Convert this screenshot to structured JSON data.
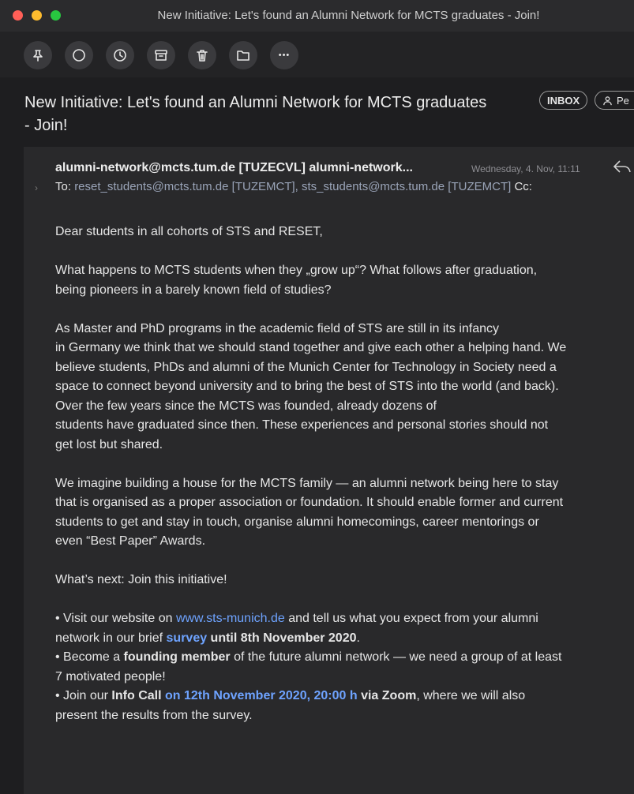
{
  "window": {
    "title": "New Initiative: Let's found an Alumni Network for MCTS graduates - Join!"
  },
  "toolbar": {
    "buttons": [
      {
        "icon": "pin-icon"
      },
      {
        "icon": "circle-icon"
      },
      {
        "icon": "clock-icon"
      },
      {
        "icon": "archive-icon"
      },
      {
        "icon": "trash-icon"
      },
      {
        "icon": "folder-icon"
      },
      {
        "icon": "more-icon",
        "glyph": "•••"
      }
    ]
  },
  "header": {
    "subject_line1": "New Initiative: Let's found an Alumni Network for MCTS graduates",
    "subject_line2": "- Join!",
    "badge_inbox": "INBOX",
    "badge_people": "Pe"
  },
  "message": {
    "from": "alumni-network@mcts.tum.de [TUZECVL] alumni-network...",
    "date": "Wednesday, 4. Nov, 11:11",
    "expand_glyph": "›",
    "to_label": "To:",
    "to_addresses": "reset_students@mcts.tum.de [TUZEMCT], sts_students@mcts.tum.de [TUZEMCT]",
    "cc_label": "Cc:",
    "greeting": "Dear students in all cohorts of STS and RESET,",
    "p1_l1": "What happens to MCTS students when they „grow up“? What follows after graduation,",
    "p1_l2": "being pioneers in a barely known field of studies?",
    "p2_l1": "As Master and PhD programs in the academic field of STS are still in its infancy",
    "p2_l2": "in Germany we think that we should stand together and give each other a helping hand. We",
    "p2_l3": "believe students, PhDs and alumni of the Munich Center for Technology in Society need a",
    "p2_l4": "space to connect beyond university and to bring the best of STS into the world (and back).",
    "p2_l5": "Over the few years since the MCTS was founded, already dozens of",
    "p2_l6": "students have graduated since then. These experiences and personal stories should not",
    "p2_l7": "get lost but shared.",
    "p3_l1": "We imagine building a house for the MCTS family — an alumni network being here to stay",
    "p3_l2": "that is organised as a proper association or foundation. It should enable former and current",
    "p3_l3": "students to get and stay in touch, organise alumni homecomings, career mentorings or",
    "p3_l4": "even “Best Paper” Awards.",
    "p4": "What’s next: Join this initiative!",
    "b1_pre": " • Visit our website on ",
    "b1_link": "www.sts-munich.de",
    "b1_mid": " and tell us what you expect from your alumni",
    "b1_l2_pre": "network in our brief ",
    "b1_survey": "survey",
    "b1_until": " until 8th November 2020",
    "b1_end": ".",
    "b2_pre": " • Become a ",
    "b2_bold": "founding member",
    "b2_mid": " of the future alumni network — we need a group of at least",
    "b2_l2": "7 motivated people!",
    "b3_pre": " • Join our ",
    "b3_bold": "Info Call",
    "b3_date": " on 12th November 2020, 20:00 h",
    "b3_zoom": " via Zoom",
    "b3_mid": ", where we will also",
    "b3_l2": "present the results from the survey."
  }
}
